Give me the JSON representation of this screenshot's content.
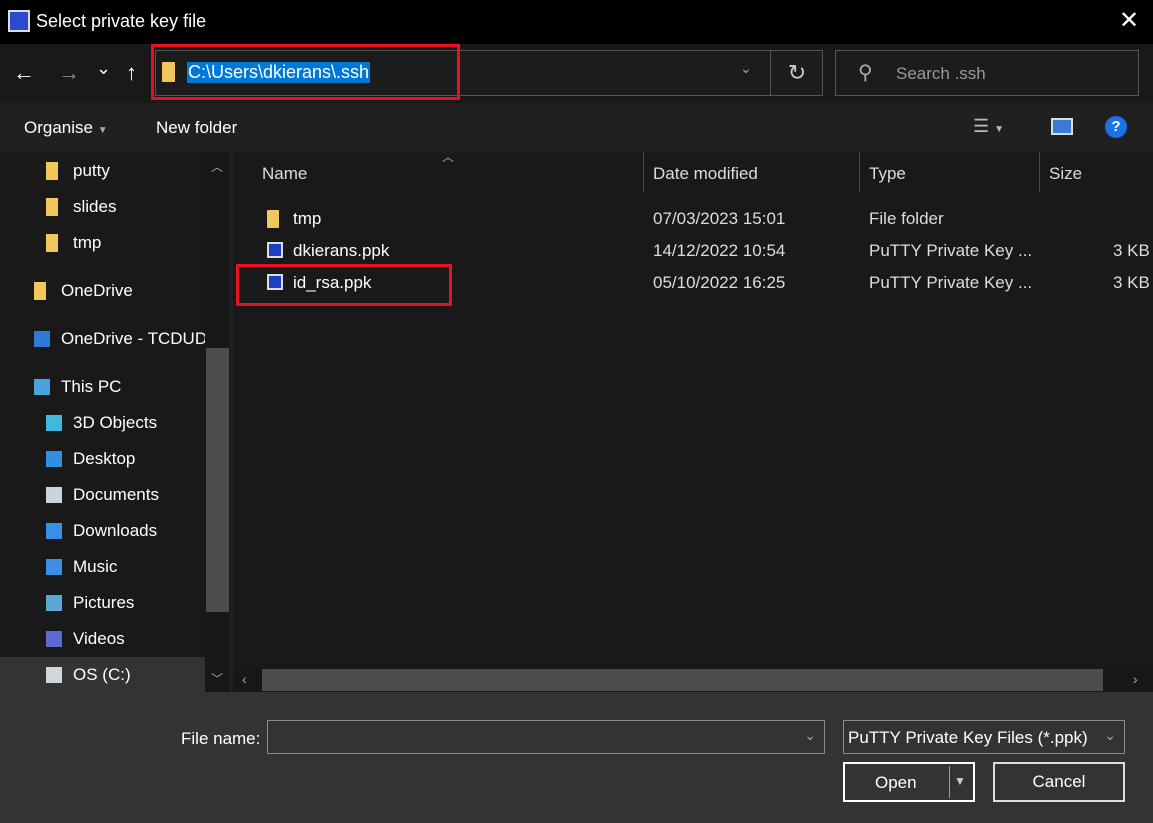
{
  "window": {
    "title": "Select private key file",
    "icon": "putty-key-icon"
  },
  "nav": {
    "back": "←",
    "forward": "→",
    "recent": "⌄",
    "up": "↑",
    "address": "C:\\Users\\dkierans\\.ssh",
    "refresh": "↻",
    "search_placeholder": "Search .ssh"
  },
  "toolbar": {
    "organise": "Organise",
    "new_folder": "New folder",
    "help": "?"
  },
  "sidebar": {
    "items": [
      {
        "label": "putty",
        "icon": "folder-icon",
        "indent": true
      },
      {
        "label": "slides",
        "icon": "folder-icon",
        "indent": true
      },
      {
        "label": "tmp",
        "icon": "folder-icon",
        "indent": true
      },
      {
        "label": "OneDrive",
        "icon": "folder-icon",
        "indent": false
      },
      {
        "label": "OneDrive - TCDUD",
        "icon": "cloud-icon",
        "indent": false
      },
      {
        "label": "This PC",
        "icon": "computer-icon",
        "indent": false
      },
      {
        "label": "3D Objects",
        "icon": "cube-icon",
        "indent": true
      },
      {
        "label": "Desktop",
        "icon": "desktop-icon",
        "indent": true
      },
      {
        "label": "Documents",
        "icon": "document-icon",
        "indent": true
      },
      {
        "label": "Downloads",
        "icon": "download-icon",
        "indent": true
      },
      {
        "label": "Music",
        "icon": "music-icon",
        "indent": true
      },
      {
        "label": "Pictures",
        "icon": "picture-icon",
        "indent": true
      },
      {
        "label": "Videos",
        "icon": "video-icon",
        "indent": true
      },
      {
        "label": "OS (C:)",
        "icon": "drive-icon",
        "indent": true,
        "selected": true
      }
    ]
  },
  "columns": {
    "name": "Name",
    "date": "Date modified",
    "type": "Type",
    "size": "Size"
  },
  "files": [
    {
      "name": "tmp",
      "date": "07/03/2023 15:01",
      "type": "File folder",
      "size": "",
      "icon": "folder-icon"
    },
    {
      "name": "dkierans.ppk",
      "date": "14/12/2022 10:54",
      "type": "PuTTY Private Key ...",
      "size": "3 KB",
      "icon": "ppk-file-icon"
    },
    {
      "name": "id_rsa.ppk",
      "date": "05/10/2022 16:25",
      "type": "PuTTY Private Key ...",
      "size": "3 KB",
      "icon": "ppk-file-icon"
    }
  ],
  "footer": {
    "file_name_label": "File name:",
    "file_name_value": "",
    "filter": "PuTTY Private Key Files (*.ppk)",
    "open": "Open",
    "cancel": "Cancel"
  },
  "colors": {
    "highlight": "#e81123",
    "selection": "#0078d7"
  }
}
